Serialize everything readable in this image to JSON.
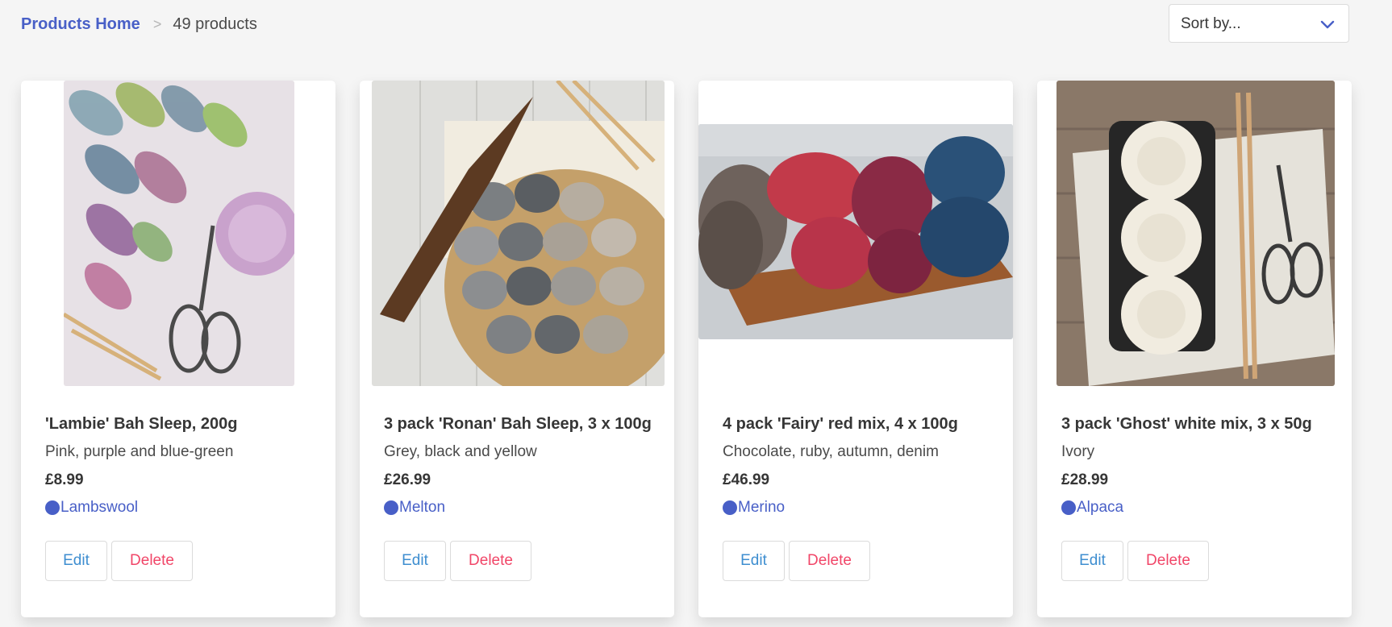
{
  "breadcrumb": {
    "home": "Products Home",
    "separator": ">",
    "count": "49 products"
  },
  "sort": {
    "label": "Sort by...",
    "icon": "chevron-down-icon"
  },
  "colors": {
    "accent": "#485fc7",
    "edit": "#3e8ed0",
    "delete": "#f14668",
    "background": "#f5f5f5"
  },
  "products": [
    {
      "title": "'Lambie' Bah Sleep, 200g",
      "description": "Pink, purple and blue-green",
      "price": "£8.99",
      "material": "Lambswool",
      "edit_label": "Edit",
      "delete_label": "Delete"
    },
    {
      "title": "3 pack 'Ronan' Bah Sleep, 3 x 100g",
      "description": "Grey, black and yellow",
      "price": "£26.99",
      "material": "Melton",
      "edit_label": "Edit",
      "delete_label": "Delete"
    },
    {
      "title": "4 pack 'Fairy' red mix, 4 x 100g",
      "description": "Chocolate, ruby, autumn, denim",
      "price": "£46.99",
      "material": "Merino",
      "edit_label": "Edit",
      "delete_label": "Delete"
    },
    {
      "title": "3 pack 'Ghost' white mix, 3 x 50g",
      "description": "Ivory",
      "price": "£28.99",
      "material": "Alpaca",
      "edit_label": "Edit",
      "delete_label": "Delete"
    }
  ]
}
